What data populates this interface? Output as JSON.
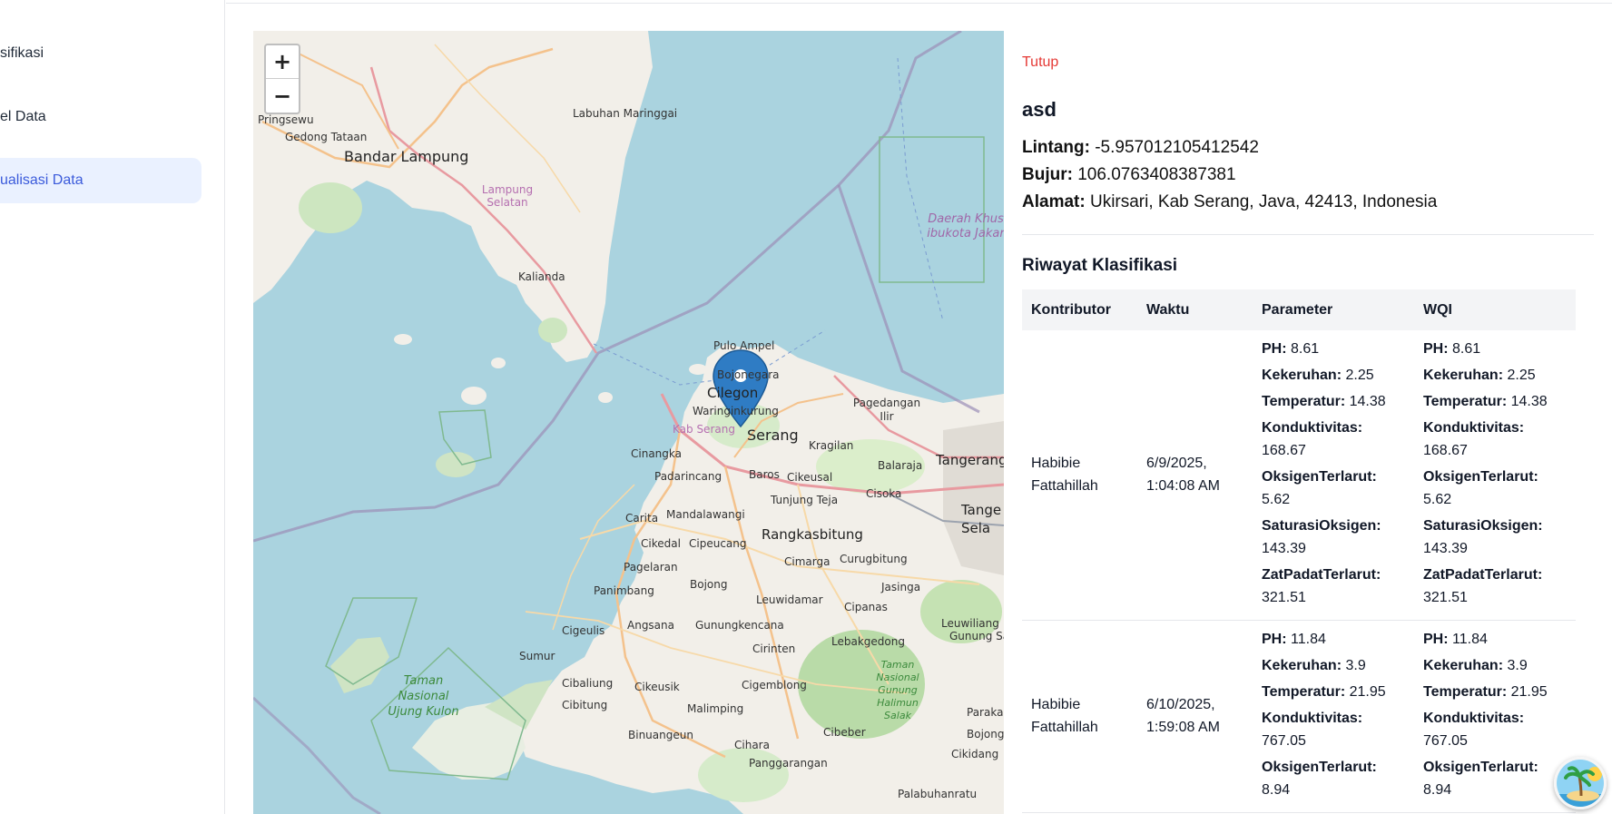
{
  "sidebar": {
    "items": [
      {
        "label": "sifikasi",
        "active": false
      },
      {
        "label": "el Data",
        "active": false
      },
      {
        "label": "ualisasi Data",
        "active": true
      }
    ]
  },
  "map": {
    "zoom_in": "+",
    "zoom_out": "−",
    "labels": {
      "pringsewu": "Pringsewu",
      "gedong_tataan": "Gedong Tataan",
      "bandar_lampung": "Bandar Lampung",
      "labuhan_maringgai": "Labuhan Maringgai",
      "lampung_selatan": "Lampung Selatan",
      "kalianda": "Kalianda",
      "daerah_khusus": "Daerah Khus ibukota Jakar",
      "pulau_ampel": "Pulo Ampel",
      "bojonegara": "Bojonegara",
      "cilegon": "Cilegon",
      "waringinkurung": "Waringinkurung",
      "kab_serang": "Kab Serang",
      "serang": "Serang",
      "kragilan": "Kragilan",
      "pagedangan_ilir": "Pagedangan Ilir",
      "tangerang": "Tangerang",
      "cinangka": "Cinangka",
      "padarincang": "Padarincang",
      "baros": "Baros",
      "cikeusal": "Cikeusal",
      "balaraja": "Balaraja",
      "tunjung_teja": "Tunjung Teja",
      "cisoka": "Cisoka",
      "carita": "Carita",
      "mandalawangi": "Mandalawangi",
      "tange_sela": "Tange Sela",
      "cikedal": "Cikedal",
      "cipeucang": "Cipeucang",
      "rangkasbitung": "Rangkasbitung",
      "pagelaran": "Pagelaran",
      "cimarga": "Cimarga",
      "curugbitung": "Curugbitung",
      "bojong": "Bojong",
      "jasinga": "Jasinga",
      "panimbang": "Panimbang",
      "leuwidamar": "Leuwidamar",
      "cipanas": "Cipanas",
      "cigeulis": "Cigeulis",
      "angsana": "Angsana",
      "gunungkencana": "Gunungkencana",
      "leuwiliang": "Leuwiliang",
      "sumur": "Sumur",
      "cirinten": "Cirinten",
      "lebakgedong": "Lebakgedong",
      "gunung_sa": "Gunung Sa",
      "taman_ujung_kulon": "Taman Nasional Ujung Kulon",
      "cibaliung": "Cibaliung",
      "cikeusik": "Cikeusik",
      "cigemblong": "Cigemblong",
      "taman_halimun": "Taman Nasional Gunung Halimun Salak",
      "paraka": "Paraka",
      "cibitung": "Cibitung",
      "malimping": "Malimping",
      "bojong2": "Bojong",
      "binuangeun": "Binuangeun",
      "cibeber": "Cibeber",
      "cihara": "Cihara",
      "cikidang": "Cikidang",
      "panggarangan": "Panggarangan",
      "palabuhanratu": "Palabuhanratu"
    }
  },
  "detail": {
    "close_label": "Tutup",
    "name": "asd",
    "lat_label": "Lintang:",
    "lat_value": "-5.957012105412542",
    "lng_label": "Bujur:",
    "lng_value": "106.0763408387381",
    "addr_label": "Alamat:",
    "addr_value": "Ukirsari, Kab Serang, Java, 42413, Indonesia",
    "history_title": "Riwayat Klasifikasi",
    "columns": [
      "Kontributor",
      "Waktu",
      "Parameter",
      "WQI"
    ],
    "rows": [
      {
        "contributor": "Habibie Fattahillah",
        "time": "6/9/2025, 1:04:08 AM",
        "params": [
          {
            "k": "PH:",
            "v": "8.61"
          },
          {
            "k": "Kekeruhan:",
            "v": "2.25"
          },
          {
            "k": "Temperatur:",
            "v": "14.38"
          },
          {
            "k": "Konduktivitas:",
            "v": "168.67"
          },
          {
            "k": "OksigenTerlarut:",
            "v": "5.62"
          },
          {
            "k": "SaturasiOksigen:",
            "v": "143.39"
          },
          {
            "k": "ZatPadatTerlarut:",
            "v": "321.51"
          }
        ]
      },
      {
        "contributor": "Habibie Fattahillah",
        "time": "6/10/2025, 1:59:08 AM",
        "params": [
          {
            "k": "PH:",
            "v": "11.84"
          },
          {
            "k": "Kekeruhan:",
            "v": "3.9"
          },
          {
            "k": "Temperatur:",
            "v": "21.95"
          },
          {
            "k": "Konduktivitas:",
            "v": "767.05"
          },
          {
            "k": "OksigenTerlarut:",
            "v": "8.94"
          }
        ]
      }
    ]
  }
}
